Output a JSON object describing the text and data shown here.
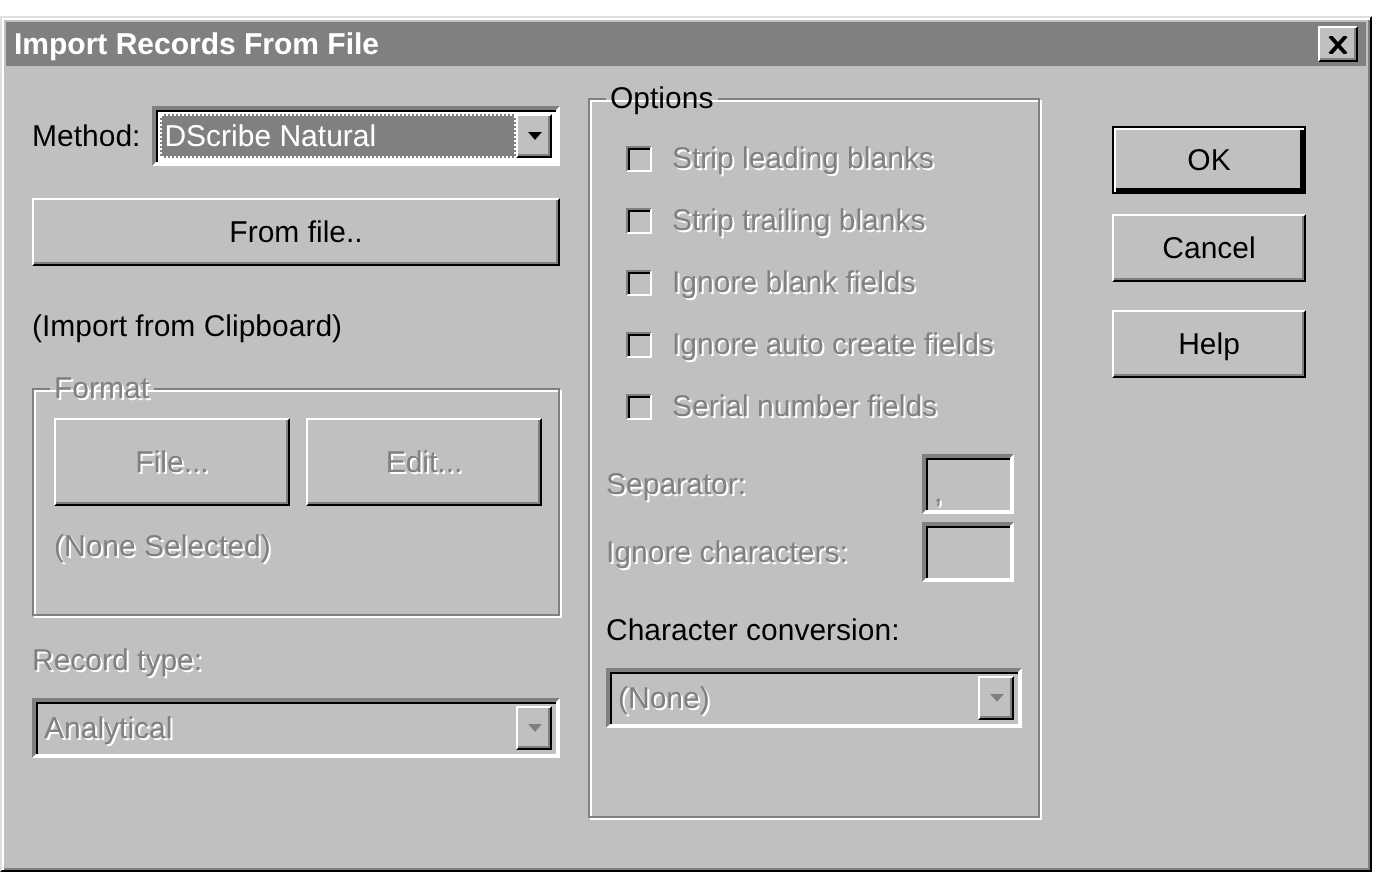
{
  "window": {
    "title": "Import Records From File"
  },
  "method": {
    "label": "Method:",
    "value": "DScribe Natural",
    "focused": true
  },
  "from_file_button": {
    "label": "From file.."
  },
  "source_note": "(Import from Clipboard)",
  "format": {
    "title": "Format",
    "disabled": true,
    "buttons": [
      {
        "label": "File...",
        "disabled": true
      },
      {
        "label": "Edit...",
        "disabled": true
      }
    ],
    "selection": "(None Selected)"
  },
  "record_type": {
    "label": "Record type:",
    "value": "Analytical",
    "disabled": true
  },
  "options": {
    "title": "Options",
    "checkboxes": [
      {
        "label": "Strip leading blanks",
        "checked": false,
        "disabled": true
      },
      {
        "label": "Strip trailing blanks",
        "checked": false,
        "disabled": true
      },
      {
        "label": "Ignore blank fields",
        "checked": false,
        "disabled": true
      },
      {
        "label": "Ignore auto create fields",
        "checked": false,
        "disabled": true
      },
      {
        "label": "Serial number fields",
        "checked": false,
        "disabled": true
      }
    ],
    "fields": [
      {
        "label": "Separator:",
        "value": ",",
        "disabled": true
      },
      {
        "label": "Ignore characters:",
        "disabled": true
      }
    ],
    "character_conversion": {
      "label": "Character conversion:",
      "value": "(None)",
      "disabled": true
    }
  },
  "buttons": [
    {
      "label": "OK",
      "default": true
    },
    {
      "label": "Cancel",
      "default": false
    },
    {
      "label": "Help",
      "default": false
    }
  ]
}
